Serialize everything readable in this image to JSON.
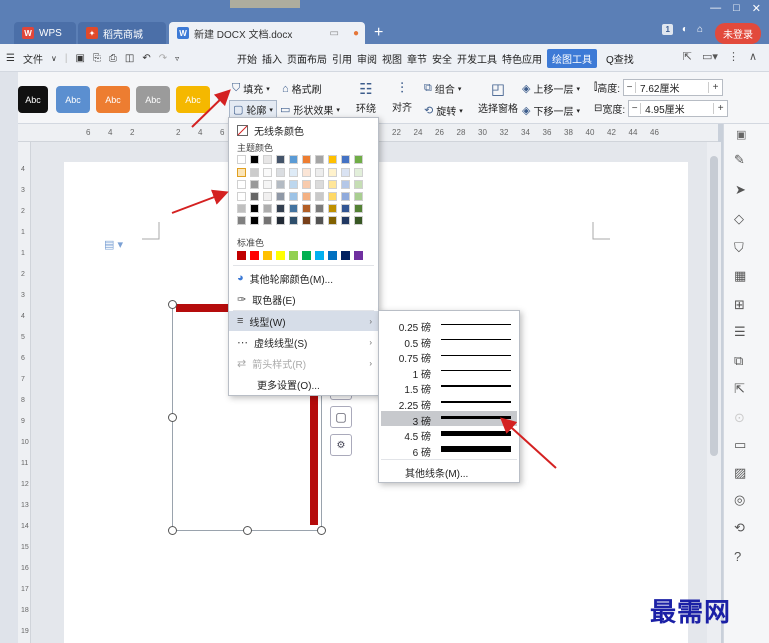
{
  "titlebar": {
    "app_tab": "WPS",
    "store_tab": "稻壳商城",
    "doc_tab": "新建 DOCX 文档.docx",
    "page_badge": "1",
    "login": "未登录",
    "minimize": "—",
    "maximize": "□",
    "close": "✕",
    "new_tab": "+"
  },
  "menu": {
    "file": "文件",
    "items": [
      "开始",
      "插入",
      "页面布局",
      "引用",
      "审阅",
      "视图",
      "章节",
      "安全",
      "开发工具",
      "特色应用",
      "绘图工具"
    ],
    "search": "Q查找"
  },
  "toolbar": {
    "swatch_label": "Abc",
    "fill": "填充",
    "format_painter": "格式刷",
    "outline": "轮廓",
    "shape_effects": "形状效果",
    "wrap": "环绕",
    "align": "对齐",
    "group": "组合",
    "rotate": "旋转",
    "selection_pane": "选择窗格",
    "bring_forward": "上移一层",
    "send_backward": "下移一层",
    "height_label": "高度:",
    "height_value": "7.62厘米",
    "width_label": "宽度:",
    "width_value": "4.95厘米"
  },
  "ruler": {
    "left_ticks": [
      "6",
      "4",
      "2",
      "2",
      "4",
      "6"
    ],
    "right_ticks": [
      "22",
      "24",
      "26",
      "28",
      "30",
      "32",
      "34",
      "36",
      "38",
      "40",
      "42",
      "44",
      "46"
    ],
    "vertical_ticks": [
      "4",
      "3",
      "2",
      "1",
      "1",
      "2",
      "3",
      "4",
      "5",
      "6",
      "7",
      "8",
      "9",
      "10",
      "11",
      "12",
      "13",
      "14",
      "15",
      "16",
      "17",
      "18",
      "19"
    ]
  },
  "outline_menu": {
    "no_line_color": "无线条颜色",
    "theme_colors": "主题颜色",
    "standard_colors": "标准色",
    "more_colors": "其他轮廓颜色(M)...",
    "eyedropper": "取色器(E)",
    "line_style": "线型(W)",
    "dash_style": "虚线线型(S)",
    "arrow_style": "箭头样式(R)",
    "more_settings": "更多设置(O)...",
    "theme_top_row": [
      "#ffffff",
      "#000000",
      "#e7e6e6",
      "#44546a",
      "#5b9bd5",
      "#ed7d31",
      "#a5a5a5",
      "#ffc000",
      "#4472c4",
      "#70ad47"
    ],
    "standard_row": [
      "#c00000",
      "#ff0000",
      "#ffc000",
      "#ffff00",
      "#92d050",
      "#00b050",
      "#00b0f0",
      "#0070c0",
      "#002060",
      "#7030a0"
    ]
  },
  "line_menu": {
    "weights": [
      "0.25 磅",
      "0.5 磅",
      "0.75 磅",
      "1 磅",
      "1.5 磅",
      "2.25 磅",
      "3 磅",
      "4.5 磅",
      "6 磅"
    ],
    "selected": "3 磅",
    "more_lines": "其他线条(M)..."
  },
  "colors": {
    "title_bar": "#5b7fb6",
    "accent_tab": "#3d7ad6",
    "shape_outline": "#b50c0c",
    "annotation_arrow": "#d42121"
  },
  "watermark": "最需网"
}
